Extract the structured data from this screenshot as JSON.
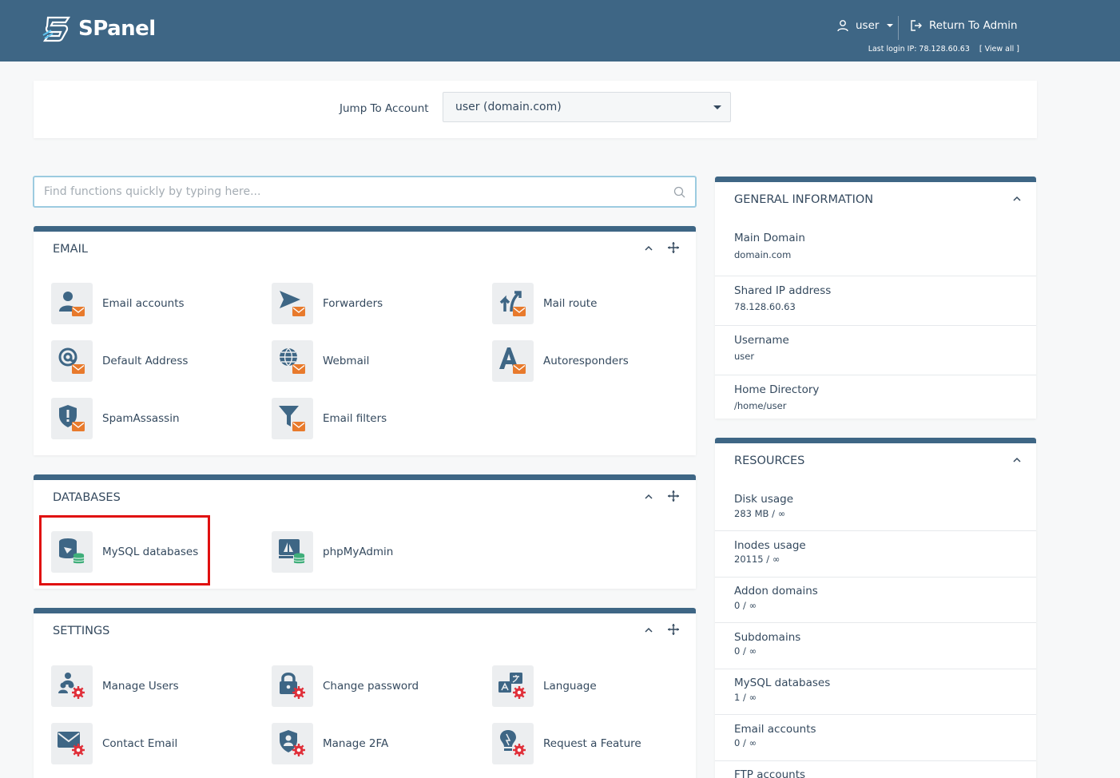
{
  "header": {
    "logo_text": "SPanel",
    "user_label": "user",
    "return_label": "Return To Admin",
    "last_login": "Last login IP: 78.128.60.63",
    "view_all": "[ View all ]"
  },
  "jump": {
    "label": "Jump To Account",
    "selected": "user (domain.com)"
  },
  "search": {
    "placeholder": "Find functions quickly by typing here..."
  },
  "sections": {
    "email": {
      "title": "EMAIL",
      "items": [
        "Email accounts",
        "Forwarders",
        "Mail route",
        "Default Address",
        "Webmail",
        "Autoresponders",
        "SpamAssassin",
        "Email filters"
      ]
    },
    "databases": {
      "title": "DATABASES",
      "items": [
        "MySQL databases",
        "phpMyAdmin"
      ]
    },
    "settings": {
      "title": "SETTINGS",
      "items": [
        "Manage Users",
        "Change password",
        "Language",
        "Contact Email",
        "Manage 2FA",
        "Request a Feature"
      ]
    }
  },
  "general": {
    "title": "GENERAL INFORMATION",
    "rows": [
      {
        "label": "Main Domain",
        "value": "domain.com"
      },
      {
        "label": "Shared IP address",
        "value": "78.128.60.63"
      },
      {
        "label": "Username",
        "value": "user"
      },
      {
        "label": "Home Directory",
        "value": "/home/user"
      }
    ]
  },
  "resources": {
    "title": "RESOURCES",
    "rows": [
      {
        "label": "Disk usage",
        "value": "283 MB / ∞"
      },
      {
        "label": "Inodes usage",
        "value": "20115 / ∞"
      },
      {
        "label": "Addon domains",
        "value": "0 / ∞"
      },
      {
        "label": "Subdomains",
        "value": "0 / ∞"
      },
      {
        "label": "MySQL databases",
        "value": "1 / ∞"
      },
      {
        "label": "Email accounts",
        "value": "0 / ∞"
      },
      {
        "label": "FTP accounts",
        "value": ""
      }
    ]
  },
  "colors": {
    "brand": "#3e6685",
    "accent_orange": "#e87a2c",
    "accent_green": "#3fae7a",
    "accent_red": "#e0303a",
    "highlight": "#e01010"
  }
}
